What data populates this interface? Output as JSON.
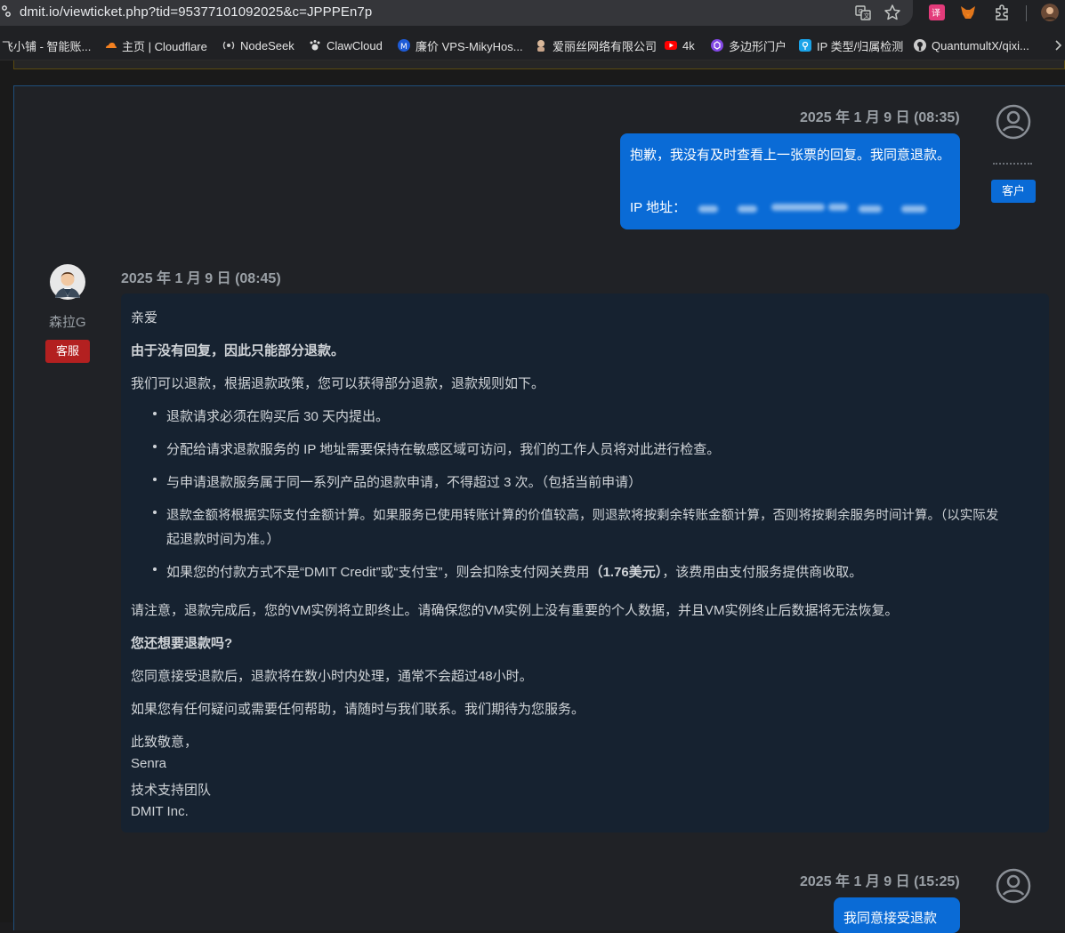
{
  "browser": {
    "url": "dmit.io/viewticket.php?tid=95377101092025&c=JPPPEn7p",
    "bookmarks": [
      {
        "label": "飞小铺 - 智能账...",
        "icon": "store-icon",
        "color": "#888888"
      },
      {
        "label": "主页 | Cloudflare",
        "icon": "cloudflare-icon",
        "color": "#f38020"
      },
      {
        "label": "NodeSeek",
        "icon": "nodeseek-icon",
        "color": "#cccccc"
      },
      {
        "label": "ClawCloud",
        "icon": "clawcloud-icon",
        "color": "#dddddd"
      },
      {
        "label": "廉价 VPS-MikyHos...",
        "icon": "mikyhost-icon",
        "color": "#1e5bd6"
      },
      {
        "label": "爱丽丝网络有限公司",
        "icon": "alice-icon",
        "color": "#d9b89a"
      },
      {
        "label": "4k",
        "icon": "youtube-icon",
        "color": "#ff0000"
      },
      {
        "label": "多边形门户",
        "icon": "polygon-icon",
        "color": "#8247e5"
      },
      {
        "label": "IP 类型/归属检测",
        "icon": "location-icon",
        "color": "#1aa3e8"
      },
      {
        "label": "QuantumultX/qixi...",
        "icon": "github-icon",
        "color": "#cccccc"
      }
    ]
  },
  "messages": [
    {
      "timestamp": "2025 年 1 月 9 日 (08:35)",
      "role": "客户",
      "lines": [
        "抱歉，我没有及时查看上一张票的回复。我同意退款。",
        "IP 地址："
      ]
    },
    {
      "timestamp": "2025 年 1 月 9 日 (08:45)",
      "author": "森拉G",
      "role": "客服",
      "greeting": "亲爱",
      "heading": "由于没有回复，因此只能部分退款。",
      "intro": "我们可以退款，根据退款政策，您可以获得部分退款，退款规则如下。",
      "rules": [
        "退款请求必须在购买后 30 天内提出。",
        "分配给请求退款服务的 IP 地址需要保持在敏感区域可访问，我们的工作人员将对此进行检查。",
        "与申请退款服务属于同一系列产品的退款申请，不得超过 3 次。（包括当前申请）",
        "退款金额将根据实际支付金额计算。如果服务已使用转账计算的价值较高，则退款将按剩余转账金额计算，否则将按剩余服务时间计算。（以实际发",
        "起退款时间为准。）"
      ],
      "fee_rule": {
        "before": "如果您的付款方式不是“DMIT Credit”或“支付宝”，则会扣除支付网关费用",
        "fee": "（1.76美元）",
        "after": "，该费用由支付服务提供商收取。"
      },
      "notice": "请注意，退款完成后，您的VM实例将立即终止。请确保您的VM实例上没有重要的个人数据，并且VM实例终止后数据将无法恢复。",
      "question": "您还想要退款吗?",
      "process": "您同意接受退款后，退款将在数小时内处理，通常不会超过48小时。",
      "contact": "如果您有任何疑问或需要任何帮助，请随时与我们联系。我们期待为您服务。",
      "signoff": [
        "此致敬意，",
        "Senra",
        "技术支持团队",
        "DMIT Inc."
      ]
    },
    {
      "timestamp": "2025 年 1 月 9 日 (15:25)",
      "role": "客户",
      "lines": [
        "我同意接受退款"
      ]
    }
  ],
  "colors": {
    "client_bubble": "#0a6bd6",
    "staff_card": "#162230",
    "staff_badge": "#b32020"
  }
}
